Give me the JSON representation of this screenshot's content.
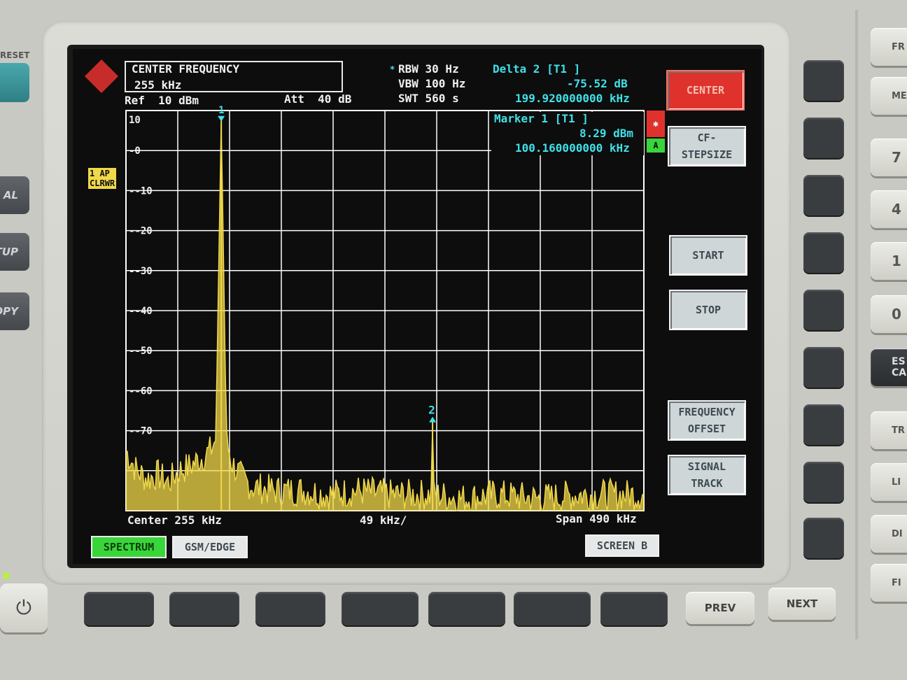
{
  "header": {
    "function_title": "CENTER FREQUENCY",
    "function_value": "255 kHz",
    "ref": "Ref  10 dBm",
    "att": "Att  40 dB",
    "rbw": "RBW 30 Hz",
    "rbw_star": "*",
    "vbw": "VBW 100 Hz",
    "swt": "SWT 560 s"
  },
  "delta_marker": {
    "title": "Delta 2 [T1 ]",
    "level": "-75.52 dB",
    "frequency": "199.920000000 kHz"
  },
  "marker1": {
    "title": "Marker 1 [T1 ]",
    "level": "8.29 dBm",
    "frequency": "100.160000000 kHz"
  },
  "side_label": {
    "line1": "1 AP",
    "line2": "CLRWR"
  },
  "status_flags": {
    "red_flag": "✱",
    "green_flag": "A"
  },
  "footer": {
    "center": "Center 255 kHz",
    "per_div": "49 kHz/",
    "span": "Span 490 kHz"
  },
  "y_ticks": [
    "10",
    "0",
    "-10",
    "-20",
    "-30",
    "-40",
    "-50",
    "-60",
    "-70"
  ],
  "softkeys": [
    {
      "label": "CENTER",
      "active": true
    },
    {
      "label": "CF-\nSTEPSIZE"
    },
    {
      "label": "START"
    },
    {
      "label": "STOP"
    },
    {
      "label": "FREQUENCY\nOFFSET"
    },
    {
      "label": "SIGNAL\nTRACK"
    }
  ],
  "tabs": {
    "spectrum": "SPECTRUM",
    "gsm": "GSM/EDGE",
    "screen": "SCREEN B"
  },
  "markers": {
    "m1": "1",
    "m2": "2"
  },
  "left_keys": [
    "RESET",
    "AL",
    "TUP",
    "OPY"
  ],
  "right_keys": [
    "FR",
    "ME",
    "7",
    "4",
    "1",
    "0",
    "ES\nCA",
    "TR",
    "LI",
    "DI",
    "FI"
  ],
  "nav_keys": {
    "prev": "PREV",
    "next": "NEXT"
  },
  "colors": {
    "trace": "#f0d84a",
    "grid": "#ffffff",
    "screen_bg": "#0d0d0d",
    "softkey_active": "#e0322c",
    "spectrum_tab": "#39d63a"
  },
  "chart_data": {
    "type": "line",
    "title": "",
    "xlabel": "",
    "ylabel": "",
    "ylim": [
      -90,
      10
    ],
    "xlim": [
      10,
      500
    ],
    "x_unit": "kHz",
    "y_unit": "dBm",
    "series": [
      {
        "x": [
          10,
          20,
          30,
          40,
          50,
          60,
          70,
          80,
          90,
          95,
          100.16,
          105,
          110,
          120,
          130,
          150,
          180,
          200,
          230,
          260,
          299,
          300.08,
          301,
          330,
          360,
          400,
          440,
          480,
          500
        ],
        "values": [
          -75,
          -80,
          -82,
          -81,
          -83,
          -80,
          -79,
          -77,
          -75,
          -72,
          8.29,
          -72,
          -78,
          -82,
          -84,
          -85,
          -85,
          -86,
          -85,
          -86,
          -86,
          -67.2,
          -86,
          -87,
          -86,
          -87,
          -86,
          -86,
          -86
        ]
      }
    ]
  }
}
